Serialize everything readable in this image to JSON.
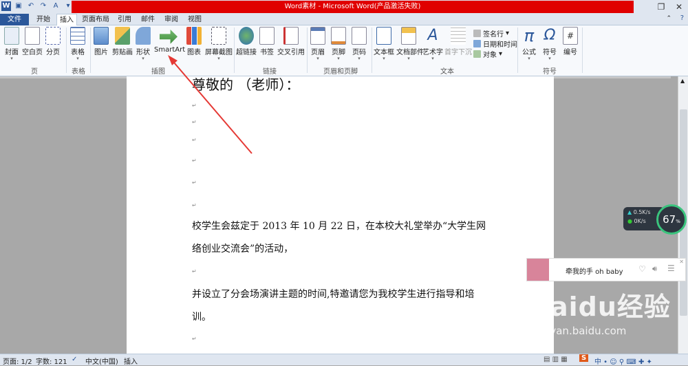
{
  "window": {
    "title": "Word素材 - Microsoft Word(产品激活失败)",
    "controls": [
      "restore-icon",
      "close-icon"
    ]
  },
  "quick_access": {
    "icons": [
      "word-logo-icon",
      "save-icon",
      "undo-icon",
      "redo-icon",
      "font-color-icon",
      "customize-icon"
    ]
  },
  "tabs": [
    "文件",
    "开始",
    "插入",
    "页面布局",
    "引用",
    "邮件",
    "审阅",
    "视图"
  ],
  "active_tab": "插入",
  "ribbon": {
    "groups": {
      "page": "页",
      "table": "表格",
      "illustrations": "插图",
      "links": "链接",
      "header_footer": "页眉和页脚",
      "text": "文本",
      "symbols": "符号"
    },
    "buttons": {
      "cover": "封面",
      "blank": "空白页",
      "page_break": "分页",
      "table": "表格",
      "picture": "图片",
      "clipart": "剪贴画",
      "shapes": "形状",
      "smartart": "SmartArt",
      "chart": "图表",
      "screenshot": "屏幕截图",
      "hyperlink": "超链接",
      "bookmark": "书签",
      "crossref": "交叉引用",
      "header": "页眉",
      "footer": "页脚",
      "page_number": "页码",
      "textbox": "文本框",
      "quickparts": "文档部件",
      "wordart": "艺术字",
      "dropcap": "首字下沉",
      "signature": "签名行",
      "datetime": "日期和时间",
      "object": "对象",
      "equation": "公式",
      "symbol": "符号",
      "number": "编号"
    }
  },
  "document": {
    "top_line": "尊敬的        （老师）：",
    "para1_line1": "校学生会兹定于 2013 年 10 月 22 日，在本校大礼堂举办“大学生网",
    "para1_line2": "络创业交流会”的活动，",
    "para2_line1": "并设立了分会场演讲主题的时间,特邀请您为我校学生进行指导和培",
    "para2_line2": "训。",
    "para_mark": "↵"
  },
  "status": {
    "page": "页面: 1/2",
    "words": "字数: 121",
    "language": "中文(中国)",
    "mode": "插入"
  },
  "net_widget": {
    "up": "0.5K/s",
    "down": "0K/s",
    "percent": "67"
  },
  "music_widget": {
    "song": "牵我的手 oh baby"
  },
  "watermark": {
    "brand": "Baidu经验",
    "url": "jingyan.baidu.com"
  },
  "colors": {
    "title_red": "#e00000",
    "file_tab": "#2b579a",
    "arrow": "#e53935"
  }
}
